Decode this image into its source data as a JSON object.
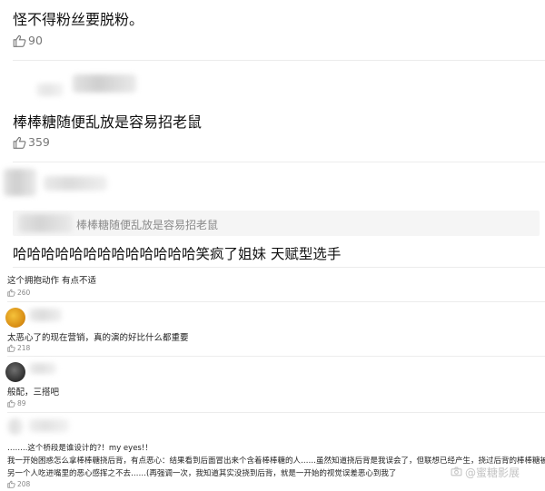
{
  "comments": [
    {
      "text": "怪不得粉丝要脱粉。",
      "likes": "90"
    },
    {
      "text": "棒棒糖随便乱放是容易招老鼠",
      "likes": "359"
    },
    {
      "quote": "棒棒糖随便乱放是容易招老鼠",
      "text": "哈哈哈哈哈哈哈哈哈哈哈哈哈笑疯了姐妹 天赋型选手"
    },
    {
      "text": "这个拥抱动作 有点不适",
      "likes": "260"
    },
    {
      "text": "太恶心了的现在营销，真的演的好比什么都重要",
      "likes": "218"
    },
    {
      "text": "般配，三搭吧",
      "likes": "89"
    },
    {
      "lines": [
        "……..这个桥段是谁设计的?！my eyes!！",
        "我一开始困惑怎么拿棒棒糖挠后背，有点恶心：结果看到后面冒出来个含着棒棒糖的人……虽然知道挠后背是我误会了，但联想已经产生，挠过后背的棒棒糖被",
        "另一个人吃进嘴里的恶心感挥之不去……(再强调一次，我知道其实没挠到后背，就是一开始的视觉误差恶心到我了"
      ],
      "likes": "208"
    }
  ],
  "watermark": {
    "text": "@蜜糖影展",
    "icon": "camera-icon"
  }
}
